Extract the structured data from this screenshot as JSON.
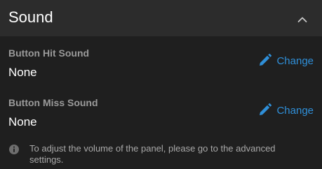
{
  "panel": {
    "title": "Sound",
    "collapse_icon": "chevron-up-icon"
  },
  "settings": [
    {
      "label": "Button Hit Sound",
      "value": "None",
      "action_label": "Change",
      "action_icon": "pencil-icon"
    },
    {
      "label": "Button Miss Sound",
      "value": "None",
      "action_label": "Change",
      "action_icon": "pencil-icon"
    }
  ],
  "info": {
    "icon": "info-icon",
    "text": "To adjust the volume of the panel, please go to the advanced settings."
  },
  "colors": {
    "background": "#1f1f1f",
    "header_background": "#2c2c2c",
    "accent": "#2f8fd8",
    "label": "#9a9a9a",
    "value": "#ffffff"
  }
}
